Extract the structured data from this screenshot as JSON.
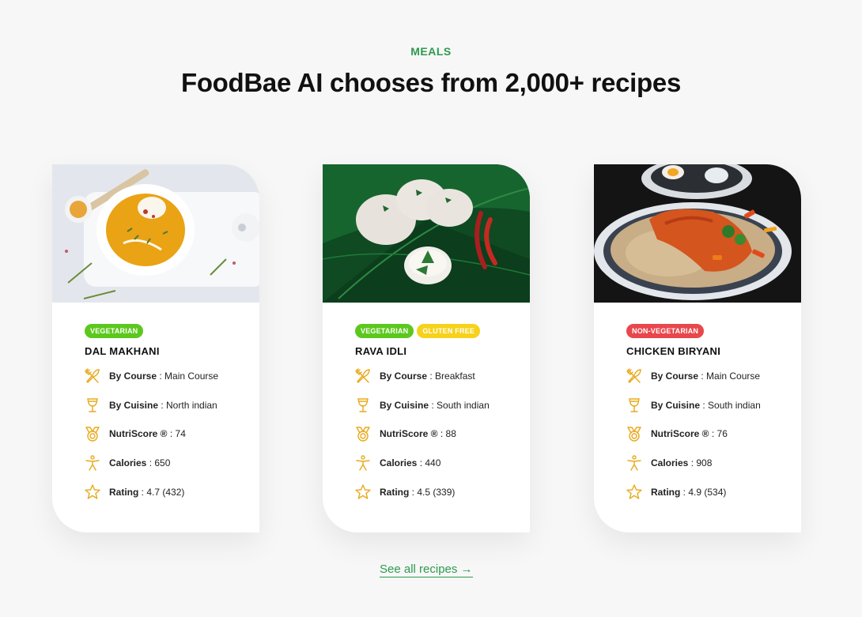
{
  "section": {
    "eyebrow": "MEALS",
    "heading": "FoodBae AI chooses from 2,000+ recipes"
  },
  "colors": {
    "accent_green": "#2e9a4e",
    "icon_gold": "#e8a91a",
    "tag_vegetarian": "#5cc81e",
    "tag_gluten_free": "#f6d21a",
    "tag_non_veg": "#e8474c"
  },
  "cards": [
    {
      "title": "DAL MAKHANI",
      "image": "dal-makhani-photo",
      "tags": [
        {
          "label": "VEGETARIAN",
          "color": "#5cc81e"
        }
      ],
      "rows": [
        {
          "icon": "fork-knife-icon",
          "label": "By Course",
          "value": " : Main Course"
        },
        {
          "icon": "wine-glass-icon",
          "label": "By Cuisine",
          "value": " : North indian"
        },
        {
          "icon": "medal-icon",
          "label": "NutriScore ®",
          "value": " : 74"
        },
        {
          "icon": "person-icon",
          "label": "Calories",
          "value": " : 650"
        },
        {
          "icon": "star-icon",
          "label": "Rating",
          "value": " : 4.7 (432)"
        }
      ]
    },
    {
      "title": "RAVA IDLI",
      "image": "rava-idli-photo",
      "tags": [
        {
          "label": "VEGETARIAN",
          "color": "#5cc81e"
        },
        {
          "label": "GLUTEN FREE",
          "color": "#f6d21a"
        }
      ],
      "rows": [
        {
          "icon": "fork-knife-icon",
          "label": "By Course",
          "value": " : Breakfast"
        },
        {
          "icon": "wine-glass-icon",
          "label": "By Cuisine",
          "value": " : South indian"
        },
        {
          "icon": "medal-icon",
          "label": "NutriScore ®",
          "value": " : 88"
        },
        {
          "icon": "person-icon",
          "label": "Calories",
          "value": " : 440"
        },
        {
          "icon": "star-icon",
          "label": "Rating",
          "value": " : 4.5 (339)"
        }
      ]
    },
    {
      "title": "CHICKEN BIRYANI",
      "image": "chicken-biryani-photo",
      "tags": [
        {
          "label": "NON-VEGETARIAN",
          "color": "#e8474c"
        }
      ],
      "rows": [
        {
          "icon": "fork-knife-icon",
          "label": "By Course",
          "value": " : Main Course"
        },
        {
          "icon": "wine-glass-icon",
          "label": "By Cuisine",
          "value": " : South indian"
        },
        {
          "icon": "medal-icon",
          "label": "NutriScore ®",
          "value": " : 76"
        },
        {
          "icon": "person-icon",
          "label": "Calories",
          "value": " : 908"
        },
        {
          "icon": "star-icon",
          "label": "Rating",
          "value": " : 4.9 (534)"
        }
      ]
    }
  ],
  "footer_link": {
    "label": "See all recipes →"
  }
}
